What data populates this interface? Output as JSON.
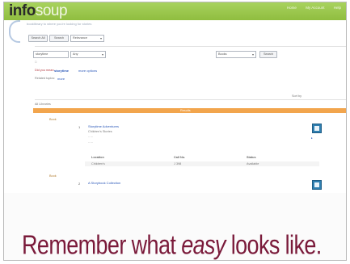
{
  "app": {
    "logo_primary": "info",
    "logo_secondary": "soup",
    "tagline": "booklibrary to where you're looking for stories",
    "top_links": [
      "Home",
      "My Account",
      "Help"
    ]
  },
  "search_bar": {
    "button1": "Search All",
    "button2": "Search",
    "option_label": "Relevance"
  },
  "filters": {
    "keyword_value": "storytime",
    "scope_select": "Any",
    "format_select": "Books",
    "go_button": "Search"
  },
  "messages": {
    "did_you_mean_label": "Did you mean:",
    "did_you_mean_link": "storytime",
    "suggest_link": "more options",
    "related_label": "Related topics:",
    "related_link": "more"
  },
  "results": {
    "header_left": "All Libraries",
    "header_right": "Sort by",
    "bar_label": "Results",
    "first_row_label": "Book",
    "second_row_label": "Book",
    "first_title": "Storytime Adventures",
    "first_subtitle": "Children's Stories",
    "second_title": "A Storybook Collection",
    "row_number_1": "1",
    "row_number_2": "2",
    "table_headers": [
      "Location",
      "Call No.",
      "Status"
    ],
    "table_values": [
      "Children's",
      "J 398",
      "Available"
    ]
  },
  "footer": {
    "caption_part1": "Remember what ",
    "caption_emphasis": "easy",
    "caption_part2": " looks like."
  },
  "colors": {
    "brand_green": "#9ac94b",
    "accent_orange": "#f2a54d",
    "caption_color": "#7a1a3a",
    "link_blue": "#2a57b8"
  }
}
